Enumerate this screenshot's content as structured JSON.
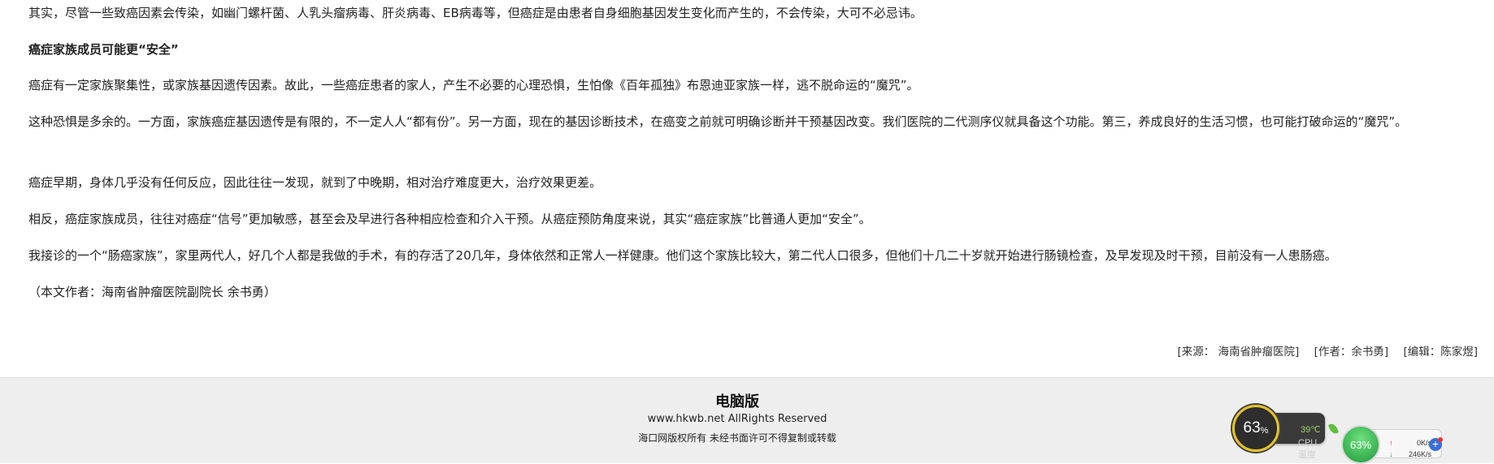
{
  "article": {
    "paragraphs": [
      "其实，尽管一些致癌因素会传染，如幽门螺杆菌、人乳头瘤病毒、肝炎病毒、EB病毒等，但癌症是由患者自身细胞基因发生变化而产生的，不会传染，大可不必忌讳。",
      "癌症家族成员可能更“安全”",
      "癌症有一定家族聚集性，或家族基因遗传因素。故此，一些癌症患者的家人，产生不必要的心理恐惧，生怕像《百年孤独》布恩迪亚家族一样，逃不脱命运的“魔咒”。",
      "这种恐惧是多余的。一方面，家族癌症基因遗传是有限的，不一定人人“都有份”。另一方面，现在的基因诊断技术，在癌变之前就可明确诊断并干预基因改变。我们医院的二代测序仪就具备这个功能。第三，养成良好的生活习惯，也可能打破命运的“魔咒”。",
      "癌症早期，身体几乎没有任何反应，因此往往一发现，就到了中晚期，相对治疗难度更大，治疗效果更差。",
      "相反，癌症家族成员，往往对癌症“信号”更加敏感，甚至会及早进行各种相应检查和介入干预。从癌症预防角度来说，其实“癌症家族”比普通人更加“安全”。",
      "我接诊的一个“肠癌家族”，家里两代人，好几个人都是我做的手术，有的存活了20几年，身体依然和正常人一样健康。他们这个家族比较大，第二代人口很多，但他们十几二十岁就开始进行肠镜检查，及早发现及时干预，目前没有一人患肠癌。",
      "（本文作者：海南省肿瘤医院副院长 余书勇）"
    ],
    "source": "[来源： 海南省肿瘤医院]",
    "author": "[作者：余书勇]",
    "editor": "[编辑：陈家煜]"
  },
  "footer": {
    "title": "电脑版",
    "copyright": "www.hkwb.net AllRights Reserved",
    "notice": "海口网版权所有 未经书面许可不得复制或转载"
  },
  "cpu_widget": {
    "percent": "63",
    "percent_unit": "%",
    "temperature": "39℃",
    "label": "CPU温度",
    "ring_color": "#e6c42a"
  },
  "net_widget": {
    "percent": "63%",
    "upload": "0K/s",
    "download": "246K/s",
    "up_arrow": "↑",
    "down_arrow": "↓",
    "plus": "+"
  }
}
